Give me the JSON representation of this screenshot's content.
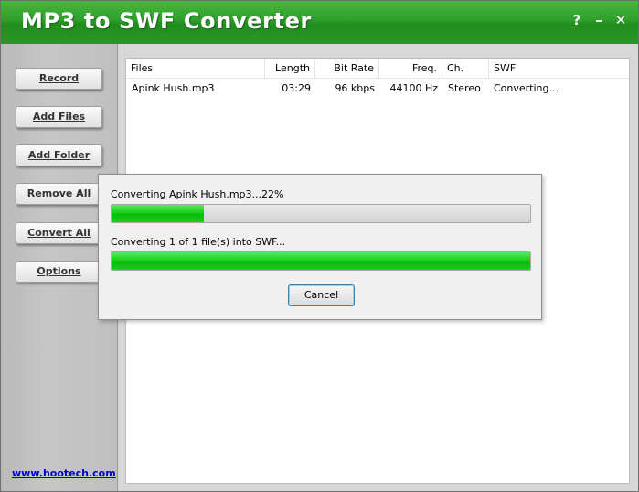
{
  "window": {
    "title": "MP3 to SWF Converter"
  },
  "titlebar": {
    "help_label": "?",
    "minimize_label": "–",
    "close_label": "✕"
  },
  "sidebar": {
    "buttons": [
      {
        "label": "Record"
      },
      {
        "label": "Add Files"
      },
      {
        "label": "Add Folder"
      },
      {
        "label": "Remove All"
      },
      {
        "label": "Convert All"
      },
      {
        "label": "Options"
      }
    ],
    "link": "www.hootech.com"
  },
  "file_list": {
    "columns": [
      "Files",
      "Length",
      "Bit Rate",
      "Freq.",
      "Ch.",
      "SWF"
    ],
    "rows": [
      {
        "file": "Apink Hush.mp3",
        "length": "03:29",
        "bitrate": "96 kbps",
        "freq": "44100 Hz",
        "ch": "Stereo",
        "swf": "Converting..."
      }
    ]
  },
  "progress_dialog": {
    "file_status": "Converting Apink Hush.mp3...22%",
    "file_progress": 0.22,
    "overall_status": "Converting 1 of 1 file(s) into SWF...",
    "overall_progress": 1.0,
    "cancel_label": "Cancel"
  },
  "colors": {
    "titlebar_green": "#2f9e2b",
    "progress_green": "#1ccf1d",
    "link_blue": "#0000cc"
  }
}
